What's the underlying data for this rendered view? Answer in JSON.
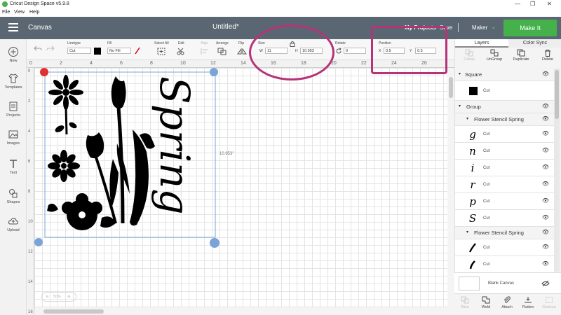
{
  "window": {
    "title": "Cricut Design Space  v5.9.8"
  },
  "menu": [
    "File",
    "View",
    "Help"
  ],
  "header": {
    "canvas_label": "Canvas",
    "project_title": "Untitled*",
    "my_projects": "My Projects",
    "save": "Save",
    "machine": "Maker",
    "make_it": "Make It"
  },
  "left_tools": [
    "New",
    "Templates",
    "Projects",
    "Images",
    "Text",
    "Shapes",
    "Upload"
  ],
  "edit_toolbar": {
    "linetype_label": "Linetype",
    "linetype_value": "Cut",
    "fill_label": "Fill",
    "fill_value": "No Fill",
    "select_all_label": "Select All",
    "edit_label": "Edit",
    "align_label": "Align",
    "arrange_label": "Arrange",
    "flip_label": "Flip",
    "size_label": "Size",
    "w_label": "W",
    "width_value": "11",
    "h_label": "H",
    "height_value": "10.953",
    "rotate_label": "Rotate",
    "rotate_value": "0",
    "position_label": "Position",
    "x_label": "X",
    "x_value": "0.5",
    "y_label": "Y",
    "y_value": "0.5"
  },
  "ruler": {
    "horizontal": [
      "0",
      "2",
      "4",
      "6",
      "8",
      "10",
      "12",
      "14",
      "16",
      "18",
      "20",
      "22",
      "24",
      "26"
    ],
    "vertical": [
      "0",
      "2",
      "4",
      "6",
      "8",
      "10",
      "12",
      "14",
      "16"
    ]
  },
  "canvas": {
    "artwork_text": "Spring",
    "height_readout": "10.953\"",
    "zoom": "50%"
  },
  "layers_panel": {
    "tabs": [
      "Layers",
      "Color Sync"
    ],
    "actions": [
      "Group",
      "UnGroup",
      "Duplicate",
      "Delete"
    ],
    "items": [
      {
        "name": "Square",
        "type": "group-header"
      },
      {
        "name": "Cut",
        "type": "layer",
        "thumb": "square"
      },
      {
        "name": "Group",
        "type": "group-header"
      },
      {
        "name": "Flower Stencil Spring",
        "type": "group-header"
      },
      {
        "name": "Cut",
        "type": "layer",
        "thumb": "g"
      },
      {
        "name": "Cut",
        "type": "layer",
        "thumb": "n"
      },
      {
        "name": "Cut",
        "type": "layer",
        "thumb": "i"
      },
      {
        "name": "Cut",
        "type": "layer",
        "thumb": "r"
      },
      {
        "name": "Cut",
        "type": "layer",
        "thumb": "p"
      },
      {
        "name": "Cut",
        "type": "layer",
        "thumb": "S"
      },
      {
        "name": "Flower Stencil Spring",
        "type": "group-header"
      },
      {
        "name": "Cut",
        "type": "layer",
        "thumb": "stroke1"
      },
      {
        "name": "Cut",
        "type": "layer",
        "thumb": "stroke2"
      }
    ],
    "blank_canvas": "Blank Canvas",
    "bottom_actions": [
      "Slice",
      "Weld",
      "Attach",
      "Flatten",
      "Contour"
    ]
  },
  "colors": {
    "header": "#5a6772",
    "make_it": "#44b14a",
    "annotation": "#b53379",
    "selection": "#7aa4d8"
  }
}
